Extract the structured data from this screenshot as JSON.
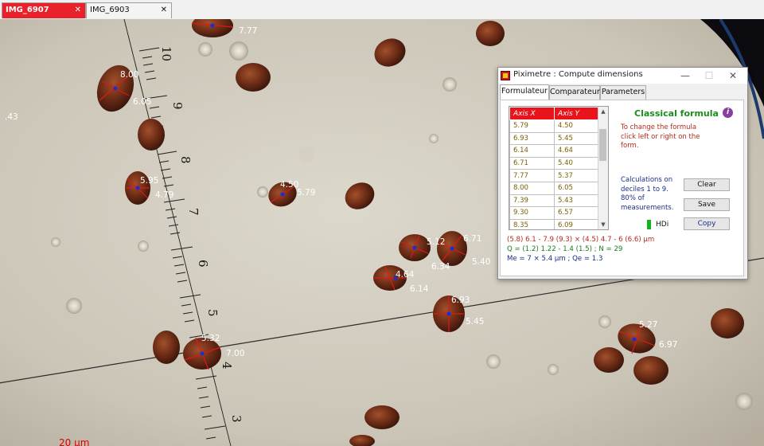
{
  "tabs": [
    {
      "label": "IMG_6907",
      "active": true
    },
    {
      "label": "IMG_6903",
      "active": false
    }
  ],
  "tab_close_glyph": "✕",
  "scale_bar_label": "20 µm",
  "ruler_numbers": [
    "10",
    "9",
    "8",
    "7",
    "6",
    "5",
    "4",
    "3"
  ],
  "measurements": [
    {
      "id": "m1",
      "a": "7.77"
    },
    {
      "id": "m2",
      "a": "8.00",
      "b": "6.05"
    },
    {
      "id": "m3",
      "a": "5.95",
      "b": "4.79"
    },
    {
      "id": "m4",
      "a": "4.50",
      "b": "5.79"
    },
    {
      "id": "m5",
      "a": "5.12",
      "b": "6.34"
    },
    {
      "id": "m6",
      "a": "6.71",
      "b": "5.40"
    },
    {
      "id": "m7",
      "a": "4.64",
      "b": "6.14"
    },
    {
      "id": "m8",
      "a": "6.93",
      "b": "5.45"
    },
    {
      "id": "m9",
      "a": "5.32",
      "b": "7.00"
    },
    {
      "id": "m10",
      "a": "5.27",
      "b": "6.97"
    },
    {
      "id": "m11",
      "a": ".43"
    }
  ],
  "dialog": {
    "title": "Piximetre : Compute dimensions",
    "window_buttons": {
      "minimize": "—",
      "maximize": "☐",
      "close": "✕"
    },
    "tabs": [
      "Formulateur",
      "Comparateur",
      "Parameters"
    ],
    "active_tab": "Formulateur",
    "table": {
      "headers": [
        "Axis X",
        "Axis Y"
      ],
      "rows": [
        [
          "5.79",
          "4.50"
        ],
        [
          "6.93",
          "5.45"
        ],
        [
          "6.14",
          "4.64"
        ],
        [
          "6.71",
          "5.40"
        ],
        [
          "7.77",
          "5.37"
        ],
        [
          "8.00",
          "6.05"
        ],
        [
          "7.39",
          "5.43"
        ],
        [
          "9.30",
          "6.57"
        ],
        [
          "8.35",
          "6.09"
        ]
      ]
    },
    "formula_title": "Classical formula",
    "info_glyph": "i",
    "hint": "To change the formula click left or right on the form.",
    "calc_note": "Calculations on deciles 1 to 9. 80% of measurements.",
    "buttons": {
      "clear": "Clear",
      "save": "Save",
      "copy": "Copy"
    },
    "hdi_label": "HDi",
    "hdi_color": "#16b21a",
    "result_line1": "(5.8) 6.1 - 7.9 (9.3) × (4.5) 4.7 - 6 (6.6) µm",
    "result_line2": "Q = (1.2) 1.22 - 1.4 (1.5) ; N = 29",
    "result_line3": "Me = 7 × 5.4 µm ; Qe = 1.3"
  },
  "colors": {
    "active_tab": "#e8212b",
    "table_header": "#e8131b",
    "formula_title": "#1c8c1c",
    "result_red": "#b52a1a",
    "result_green": "#1c7a1c",
    "result_blue": "#1a2f8a"
  }
}
